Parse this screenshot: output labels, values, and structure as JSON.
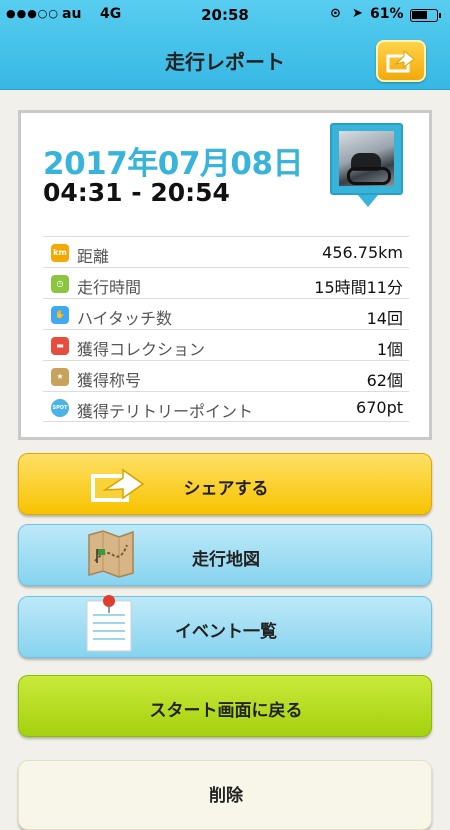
{
  "status_bar": {
    "signal": "●●●○○",
    "carrier": "au",
    "network": "4G",
    "time": "20:58",
    "battery": "61%",
    "battery_level": 0.61
  },
  "nav": {
    "title": "走行レポート"
  },
  "report": {
    "date": "2017年07月08日",
    "time_range": "04:31 - 20:54",
    "stats": [
      {
        "icon": "distance-km-icon",
        "icon_text": "km",
        "icon_color": "#f5a800",
        "label": "距離",
        "value": "456.75km"
      },
      {
        "icon": "clock-icon",
        "icon_text": "◷",
        "icon_color": "#8cc63f",
        "label": "走行時間",
        "value": "15時間11分"
      },
      {
        "icon": "hand-wave-icon",
        "icon_text": "✋",
        "icon_color": "#3fa9f5",
        "label": "ハイタッチ数",
        "value": "14回"
      },
      {
        "icon": "car-icon",
        "icon_text": "▬",
        "icon_color": "#e74c3c",
        "label": "獲得コレクション",
        "value": "1個"
      },
      {
        "icon": "medal-icon",
        "icon_text": "★",
        "icon_color": "#c8a15a",
        "label": "獲得称号",
        "value": "62個"
      },
      {
        "icon": "spot-icon",
        "icon_text": "SPOT",
        "icon_color": "#4ab4e6",
        "label": "獲得テリトリーポイント",
        "value": "670pt"
      }
    ]
  },
  "buttons": {
    "share": "シェアする",
    "map": "走行地図",
    "events": "イベント一覧",
    "back_to_start": "スタート画面に戻る",
    "delete": "削除"
  },
  "colors": {
    "header": "#36b8e4",
    "accent_date": "#38b3da",
    "share_button": "#f7c300",
    "map_button": "#87d3ef",
    "start_button": "#a5d10e"
  }
}
